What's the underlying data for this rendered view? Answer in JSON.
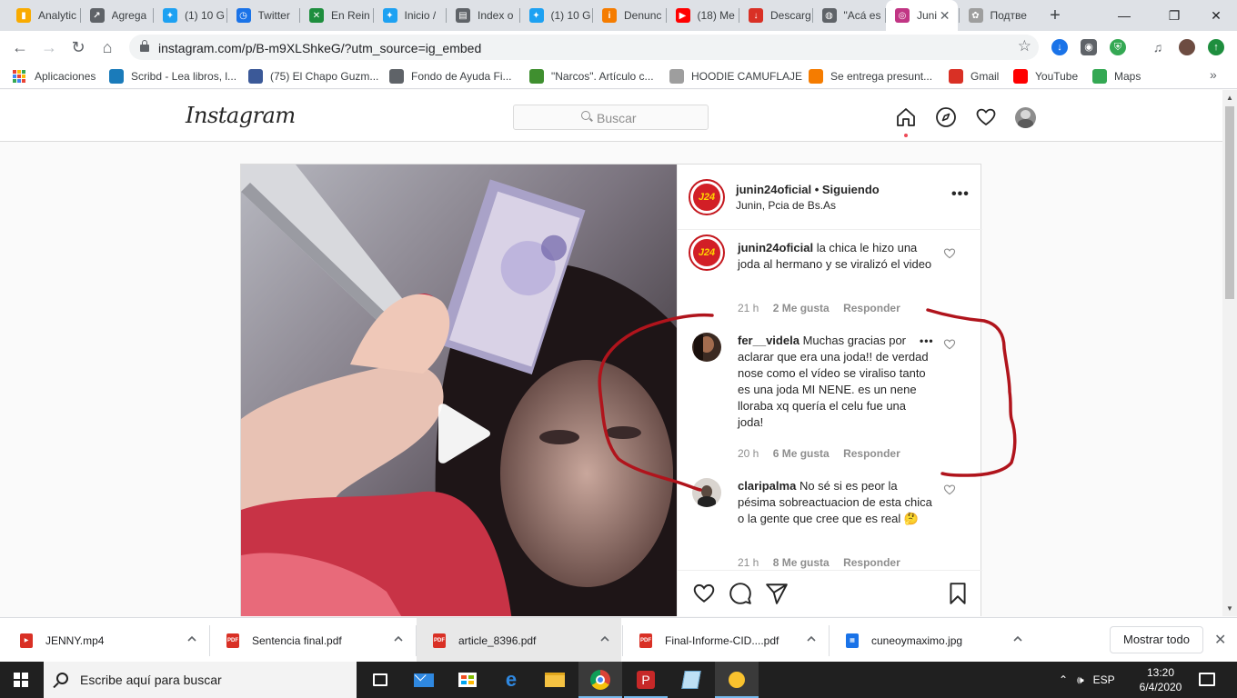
{
  "browser": {
    "tabs": [
      {
        "label": "Analytic",
        "color": "#f9ab00",
        "glyph": "▮"
      },
      {
        "label": "Agrega",
        "color": "#5f6368",
        "glyph": "↗"
      },
      {
        "label": "(1) 10 G",
        "color": "#1da1f2",
        "glyph": "✦"
      },
      {
        "label": "Twitter",
        "color": "#1a73e8",
        "glyph": "◷"
      },
      {
        "label": "En Rein",
        "color": "#1e8e3e",
        "glyph": "✕"
      },
      {
        "label": "Inicio /",
        "color": "#1da1f2",
        "glyph": "✦"
      },
      {
        "label": "Index o",
        "color": "#5f6368",
        "glyph": "▤"
      },
      {
        "label": "(1) 10 G",
        "color": "#1da1f2",
        "glyph": "✦"
      },
      {
        "label": "Denunc",
        "color": "#f57c00",
        "glyph": "i"
      },
      {
        "label": "(18) Me",
        "color": "#ff0000",
        "glyph": "▶"
      },
      {
        "label": "Descarg",
        "color": "#d93025",
        "glyph": "↓"
      },
      {
        "label": "\"Acá es",
        "color": "#5f6368",
        "glyph": "◍"
      },
      {
        "label": "Juni",
        "color": "#c13584",
        "glyph": "◎",
        "active": true
      },
      {
        "label": "Подтве",
        "color": "#9e9e9e",
        "glyph": "✿"
      }
    ],
    "url": "instagram.com/p/B-m9XLShkeG/?utm_source=ig_embed",
    "bookmarks": [
      {
        "label": "Aplicaciones",
        "icon": "apps-grid-icon"
      },
      {
        "label": "Scribd - Lea libros, l...",
        "icon": "scribd-icon",
        "color": "#1a7bba"
      },
      {
        "label": "(75) El Chapo Guzm...",
        "icon": "facebook-icon",
        "color": "#3b5998"
      },
      {
        "label": "Fondo de Ayuda Fi...",
        "icon": "globe-icon",
        "color": "#5f6368"
      },
      {
        "label": "\"Narcos\". Artículo c...",
        "icon": "site-icon",
        "color": "#3f8f2f"
      },
      {
        "label": "HOODIE CAMUFLAJE",
        "icon": "globe-icon",
        "color": "#9e9e9e"
      },
      {
        "label": "Se entrega presunt...",
        "icon": "info-icon",
        "color": "#f57c00"
      },
      {
        "label": "Gmail",
        "icon": "gmail-icon",
        "color": "#d93025"
      },
      {
        "label": "YouTube",
        "icon": "youtube-icon",
        "color": "#ff0000"
      },
      {
        "label": "Maps",
        "icon": "maps-icon",
        "color": "#34a853"
      }
    ]
  },
  "instagram": {
    "logo": "Instagram",
    "search_placeholder": "Buscar",
    "post": {
      "username": "junin24oficial",
      "following": "• Siguiendo",
      "location": "Junin, Pcia de Bs.As",
      "avatar_text": "J24",
      "comments": [
        {
          "user": "junin24oficial",
          "text": "la chica le hizo una joda al hermano y se viralizó el video",
          "time": "21 h",
          "likes": "2 Me gusta",
          "reply": "Responder"
        },
        {
          "user": "fer__videla",
          "text": "Muchas gracias por aclarar que era una joda!! de verdad nose como el vídeo se viraliso tanto es una joda MI NENE. es un nene lloraba xq quería el celu fue una joda!",
          "time": "20 h",
          "likes": "6 Me gusta",
          "reply": "Responder"
        },
        {
          "user": "claripalma",
          "text": "No sé si es peor la pésima sobreactuacion de esta chica o la gente que cree que es real 🤔",
          "time": "21 h",
          "likes": "8 Me gusta",
          "reply": "Responder"
        }
      ]
    }
  },
  "downloads": [
    {
      "name": "JENNY.mp4",
      "type": "video"
    },
    {
      "name": "Sentencia final.pdf",
      "type": "pdf"
    },
    {
      "name": "article_8396.pdf",
      "type": "pdf",
      "highlight": true
    },
    {
      "name": "Final-Informe-CID....pdf",
      "type": "pdf"
    },
    {
      "name": "cuneoymaximo.jpg",
      "type": "image"
    }
  ],
  "downloads_show_all": "Mostrar todo",
  "taskbar": {
    "search_placeholder": "Escribe aquí para buscar",
    "language": "ESP",
    "time": "13:20",
    "date": "6/4/2020"
  }
}
